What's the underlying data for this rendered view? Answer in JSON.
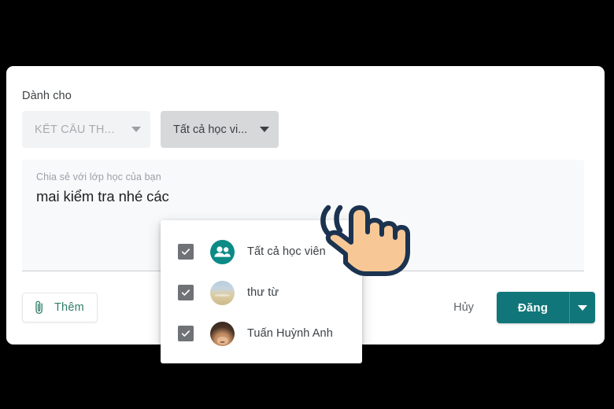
{
  "card": {
    "field_label": "Dành cho",
    "selects": [
      {
        "name": "topic",
        "value": "KẾT CẤU TH...",
        "icon": "chevron-down-icon"
      },
      {
        "name": "audience",
        "value": "Tất cả học vi...",
        "icon": "chevron-down-icon"
      }
    ],
    "composer": {
      "placeholder": "Chia sẻ với lớp học của bạn",
      "value": "mai kiểm tra nhé các"
    },
    "footer": {
      "attach_label": "Thêm",
      "attach_icon": "paperclip-icon",
      "cancel_label": "Hủy",
      "post_label": "Đăng",
      "post_more_icon": "chevron-down-icon"
    }
  },
  "dropdown": {
    "items": [
      {
        "label": "Tất cả học viên",
        "checked": true,
        "avatar": "group-icon"
      },
      {
        "label": "thư từ",
        "checked": true,
        "avatar": "beach-photo-avatar"
      },
      {
        "label": "Tuấn Huỳnh Anh",
        "checked": true,
        "avatar": "person-photo-avatar"
      }
    ]
  },
  "cursor": {
    "icon": "hand-pointer-tap-icon"
  },
  "colors": {
    "accent_teal": "#11767a",
    "attach_green": "#2e7d68",
    "select_active_gray": "#d6d8d9",
    "select_idle_gray": "#f1f3f4",
    "checkbox_gray": "#6f7276",
    "group_avatar_teal": "#0b8a86",
    "backdrop": "#000000"
  }
}
